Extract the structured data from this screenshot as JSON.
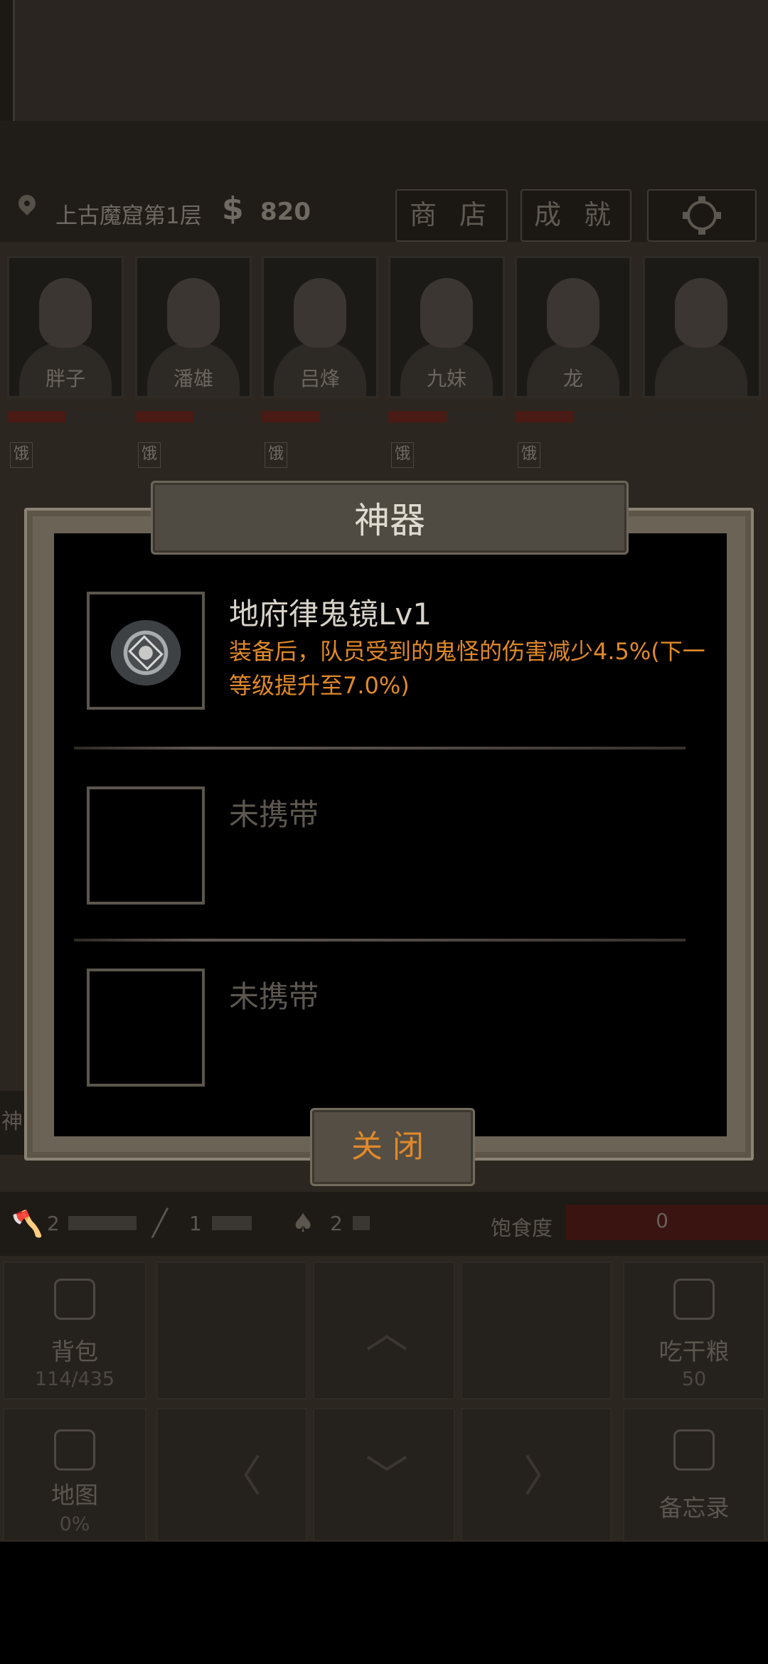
{
  "location": {
    "name": "上古魔窟第1层",
    "currency_symbol": "$",
    "money": "820"
  },
  "top_buttons": {
    "shop": "商 店",
    "achievements": "成 就"
  },
  "team": [
    {
      "name": "胖子",
      "status": "饿"
    },
    {
      "name": "潘雄",
      "status": "饿"
    },
    {
      "name": "吕烽",
      "status": "饿"
    },
    {
      "name": "九妹",
      "status": "饿"
    },
    {
      "name": "龙",
      "status": "饿"
    },
    {
      "name": "",
      "status": ""
    }
  ],
  "modal": {
    "title": "神器",
    "slots": [
      {
        "name": "地府律鬼镜Lv1",
        "description": "装备后，队员受到的鬼怪的伤害减少4.5%(下一等级提升至7.0%)",
        "icon": "mirror-icon"
      },
      {
        "name": "未携带"
      },
      {
        "name": "未携带"
      }
    ],
    "close_label": "关闭"
  },
  "left_tab_label": "神",
  "tools": [
    {
      "icon": "axe-icon",
      "count": "2"
    },
    {
      "icon": "pick-icon",
      "count": "1"
    },
    {
      "icon": "shovel-icon",
      "count": "2"
    }
  ],
  "satiety": {
    "label": "饱食度",
    "value": "0"
  },
  "grid": {
    "backpack": {
      "label": "背包",
      "sub": "114/435"
    },
    "eat": {
      "label": "吃干粮",
      "sub": "50"
    },
    "map": {
      "label": "地图",
      "sub": "0%"
    },
    "memo": {
      "label": "备忘录"
    }
  }
}
